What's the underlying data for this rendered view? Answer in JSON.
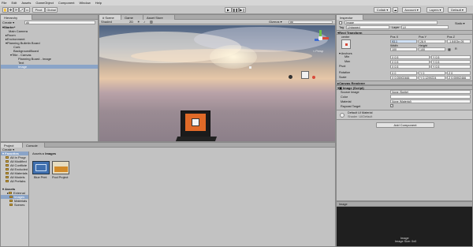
{
  "menu": [
    "File",
    "Edit",
    "Assets",
    "GameObject",
    "Component",
    "Window",
    "Help"
  ],
  "toolbar": {
    "collab": "Collab ▾",
    "account": "Account ▾",
    "layers": "Layers ▾",
    "layout": "Default ▾",
    "pivot": "Pivot",
    "global": "Global"
  },
  "hierarchy": {
    "tab": "Hierarchy",
    "create": "Create ▾",
    "search_placeholder": "All",
    "items": [
      "Starter*",
      "Main Camera",
      "Room",
      "Environment",
      "Planning Bulletin Board",
      "Cork",
      "BackgroundBoard",
      "Title - Canvas",
      "Planning Board - Image",
      "Text",
      "Image"
    ]
  },
  "scene": {
    "tabs": [
      "Scene",
      "Game",
      "Asset Store"
    ],
    "shading": "Shaded",
    "mode": "2D",
    "gizmos": "Gizmos ▾",
    "search": "All",
    "persp": "< Persp"
  },
  "inspector": {
    "tab": "Inspector",
    "name": "Image",
    "static": "Static ▾",
    "tag_label": "Tag",
    "tag": "Untagged",
    "layer_label": "Layer",
    "layer": "UI",
    "rect_header": "Rect Transform",
    "anchor_mode": "center",
    "pos_labels": [
      "Pos X",
      "Pos Y",
      "Pos Z"
    ],
    "pos_values": [
      "93.1",
      "28.9",
      "-1.8403e-05"
    ],
    "size_labels": [
      "Width",
      "Height"
    ],
    "size_values": [
      "100",
      "100"
    ],
    "anchors_label": "Anchors",
    "min_label": "Min",
    "max_label": "Max",
    "pivot_label": "Pivot",
    "min": [
      "X 0.5",
      "Y 0.5"
    ],
    "max": [
      "X 0.5",
      "Y 0.5"
    ],
    "pivot": [
      "X 0.5",
      "Y 0.5"
    ],
    "rotation_label": "Rotation",
    "rotation": [
      "X 0",
      "Y 0",
      "Z 0"
    ],
    "scale_label": "Scale",
    "scale": [
      "X 0.05902466",
      "Y 0.1299224",
      "Z 0.05902466"
    ],
    "canvas_renderer": "Canvas Renderer",
    "image_header": "Image (Script)",
    "source_label": "Source Image",
    "source": "None (Sprite)",
    "color_label": "Color",
    "material_label": "Material",
    "material": "None (Material)",
    "raycast_label": "Raycast Target",
    "default_material": "Default UI Material",
    "shader_label": "Shader",
    "shader": "UI/Default",
    "add_component": "Add Component"
  },
  "project": {
    "tabs": [
      "Project",
      "Console"
    ],
    "create": "Create ▾",
    "favorites_header": "Favorites",
    "favorites": [
      "All In Progr",
      "All Modified",
      "All Conflicte",
      "All Excluded",
      "All Materials",
      "All Models",
      "All Prefabs"
    ],
    "assets_header": "Assets",
    "assets_tree": [
      "External",
      "Images",
      "Materials",
      "Scenes"
    ],
    "breadcrumb": [
      "Assets",
      "Images"
    ],
    "files": [
      "Blue Print",
      "Pool Project"
    ]
  },
  "preview": {
    "title": "Image",
    "caption": "Image",
    "size": "Image Size: 0x0"
  },
  "colors": {
    "accent": "#3a72b0",
    "sky_top": "#566a86",
    "sky_mid": "#c9a98a",
    "ground": "#9a8b93"
  }
}
